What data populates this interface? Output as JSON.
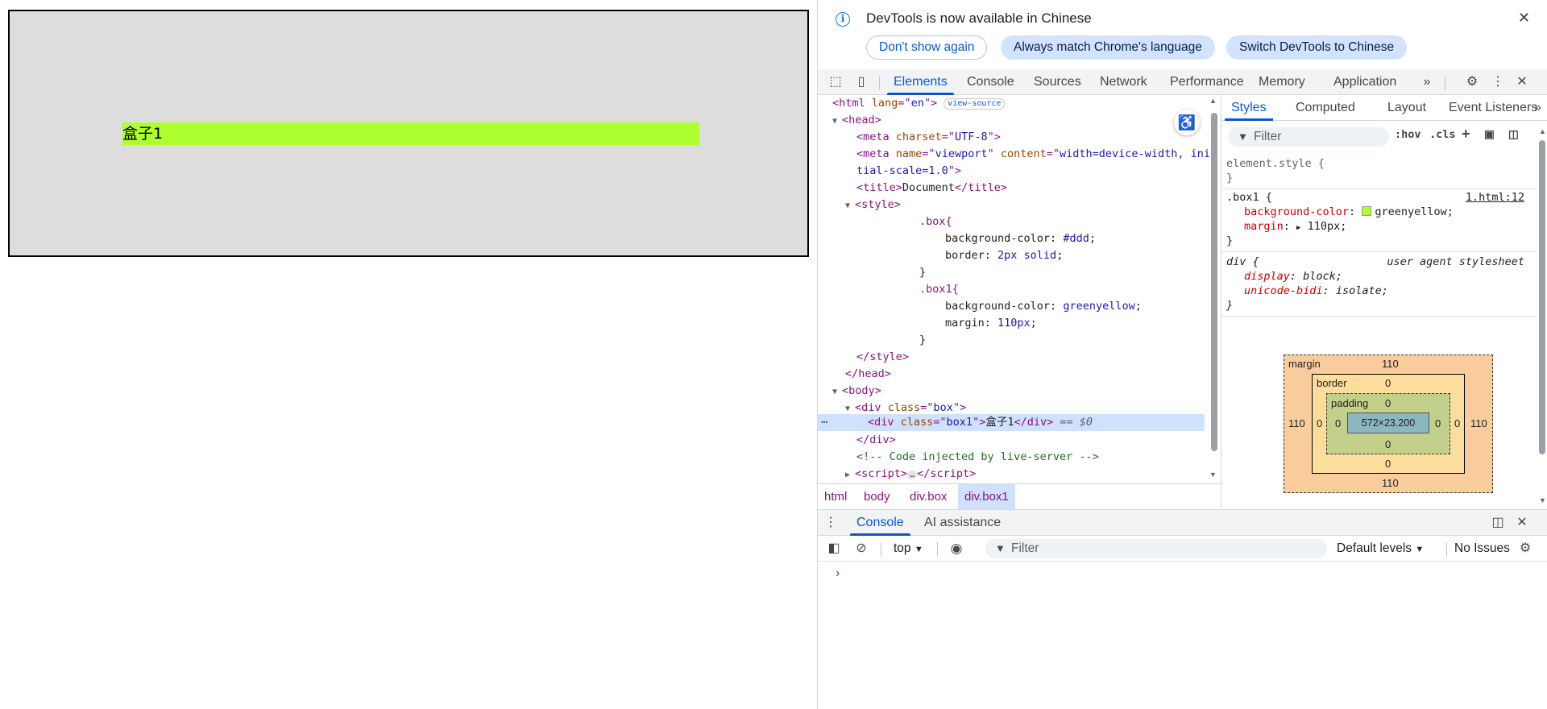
{
  "page": {
    "box1_text": "盒子1"
  },
  "banner": {
    "title": "DevTools is now available in Chinese",
    "buttons": [
      "Don't show again",
      "Always match Chrome's language",
      "Switch DevTools to Chinese"
    ]
  },
  "main_tabs": {
    "items": [
      "Elements",
      "Console",
      "Sources",
      "Network",
      "Performance",
      "Memory",
      "Application"
    ],
    "active": "Elements"
  },
  "dom": {
    "html_lang": "en",
    "view_source": "view-source",
    "meta_charset": "UTF-8",
    "meta_viewport_line1": "width=device-width, ini",
    "meta_viewport_line2": "tial-scale=1.0",
    "title_text": "Document",
    "css_box_sel": ".box{",
    "css_box_bg": "#ddd",
    "css_box_border": "2px solid",
    "css_box1_sel": ".box1{",
    "css_box1_bg": "greenyellow",
    "css_box1_margin": "110px",
    "box_class": "box",
    "box1_class": "box1",
    "box1_text": "盒子1",
    "selected_marker": "== $0",
    "comment": "<!-- Code injected by live-server -->",
    "ellipsis": "…"
  },
  "breadcrumbs": [
    "html",
    "body",
    "div.box",
    "div.box1"
  ],
  "styles_tabs": [
    "Styles",
    "Computed",
    "Layout",
    "Event Listeners"
  ],
  "styles": {
    "filter_placeholder": "Filter",
    "hov": ":hov",
    "cls": ".cls",
    "element_style": "element.style {",
    "box1_selector": ".box1 {",
    "box1_source": "1.html:12",
    "box1_bg_prop": "background-color",
    "box1_bg_val": "greenyellow;",
    "box1_margin_prop": "margin",
    "box1_margin_val": "110px;",
    "ua_selector": "div {",
    "ua_label": "user agent stylesheet",
    "ua_display_prop": "display",
    "ua_display_val": "block;",
    "ua_bidi_prop": "unicode-bidi",
    "ua_bidi_val": "isolate;",
    "close_brace": "}"
  },
  "box_model": {
    "margin_label": "margin",
    "border_label": "border",
    "padding_label": "padding",
    "margin_top": "110",
    "margin_right": "110",
    "margin_bottom": "110",
    "margin_left": "110",
    "border_top": "0",
    "border_right": "0",
    "border_bottom": "0",
    "border_left": "0",
    "padding_top": "0",
    "padding_right": "0",
    "padding_bottom": "0",
    "padding_left": "0",
    "content": "572×23.200"
  },
  "drawer": {
    "tabs": [
      "Console",
      "AI assistance"
    ],
    "context": "top",
    "filter_placeholder": "Filter",
    "levels": "Default levels",
    "issues": "No Issues",
    "prompt": "›"
  },
  "colors": {
    "accent": "#0b57d0",
    "box_bg": "#dddddd",
    "box1_bg": "#adff2f"
  }
}
